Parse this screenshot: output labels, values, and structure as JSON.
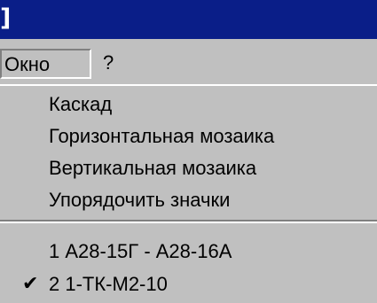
{
  "window": {
    "title_fragment": "]"
  },
  "menubar": {
    "items": [
      {
        "label": "Окно"
      },
      {
        "label": "?"
      }
    ]
  },
  "dropdown": {
    "items": [
      {
        "label": "Каскад"
      },
      {
        "label": "Горизонтальная мозаика"
      },
      {
        "label": "Вертикальная мозаика"
      },
      {
        "label": "Упорядочить значки"
      }
    ],
    "windows": [
      {
        "label": "1 А28-15Г - А28-16А",
        "checked": false
      },
      {
        "label": "2 1-ТК-М2-10",
        "checked": true
      }
    ],
    "check_icon": "checkmark-icon"
  },
  "colors": {
    "titlebar": "#0a1e88",
    "menu_bg": "#c0c0c0",
    "text": "#000000",
    "title_text": "#ffffff"
  }
}
